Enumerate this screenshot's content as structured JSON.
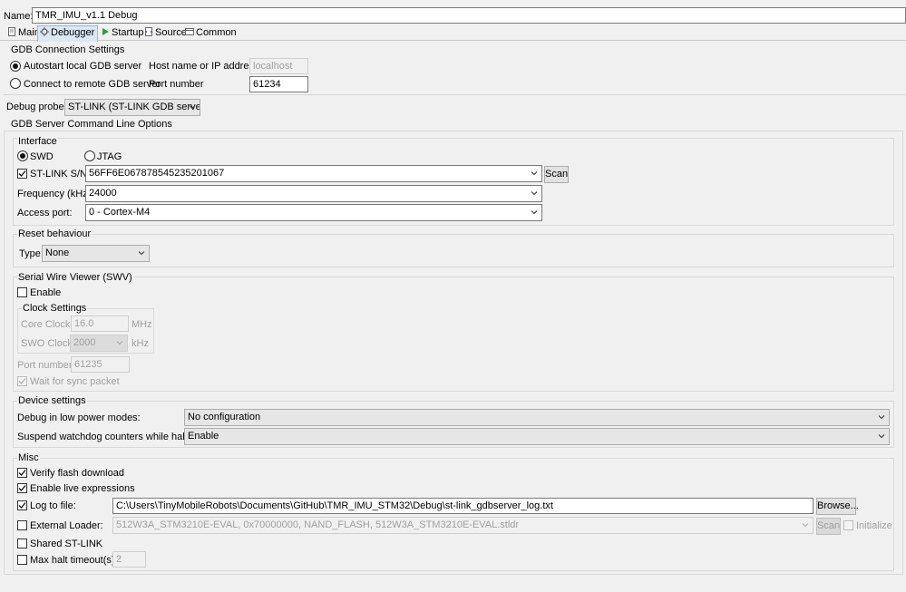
{
  "name": {
    "label": "Name:",
    "value": "TMR_IMU_v1.1 Debug"
  },
  "tabs": [
    {
      "label": "Main",
      "icon": "main-tab-icon"
    },
    {
      "label": "Debugger",
      "icon": "debugger-tab-icon"
    },
    {
      "label": "Startup",
      "icon": "startup-tab-icon"
    },
    {
      "label": "Source",
      "icon": "source-tab-icon"
    },
    {
      "label": "Common",
      "icon": "common-tab-icon"
    }
  ],
  "gdb_connection": {
    "title": "GDB Connection Settings",
    "autostart_label": "Autostart local GDB server",
    "remote_label": "Connect to remote GDB server",
    "host_label": "Host name or IP address",
    "host_value": "localhost",
    "port_label": "Port number",
    "port_value": "61234"
  },
  "debug_probe": {
    "label": "Debug probe",
    "value": "ST-LINK (ST-LINK GDB server)"
  },
  "server_options": {
    "title": "GDB Server Command Line Options"
  },
  "interface": {
    "title": "Interface",
    "swd_label": "SWD",
    "jtag_label": "JTAG",
    "stlink_sn_label": "ST-LINK S/N",
    "stlink_sn_value": "56FF6E067878545235201067",
    "scan_label": "Scan",
    "frequency_label": "Frequency (kHz):",
    "frequency_value": "24000",
    "access_port_label": "Access port:",
    "access_port_value": "0 - Cortex-M4"
  },
  "reset": {
    "title": "Reset behaviour",
    "type_label": "Type:",
    "type_value": "None"
  },
  "swv": {
    "title": "Serial Wire Viewer (SWV)",
    "enable_label": "Enable",
    "clock_title": "Clock Settings",
    "core_clock_label": "Core Clock:",
    "core_clock_value": "16.0",
    "core_clock_unit": "MHz",
    "swo_clock_label": "SWO Clock:",
    "swo_clock_value": "2000",
    "swo_clock_unit": "kHz",
    "port_label": "Port number:",
    "port_value": "61235",
    "wait_sync_label": "Wait for sync packet"
  },
  "device": {
    "title": "Device settings",
    "low_power_label": "Debug in low power modes:",
    "low_power_value": "No configuration",
    "watchdog_label": "Suspend watchdog counters while halted:",
    "watchdog_value": "Enable"
  },
  "misc": {
    "title": "Misc",
    "verify_flash_label": "Verify flash download",
    "live_expr_label": "Enable live expressions",
    "log_file_label": "Log to file:",
    "log_file_value": "C:\\Users\\TinyMobileRobots\\Documents\\GitHub\\TMR_IMU_STM32\\Debug\\st-link_gdbserver_log.txt",
    "browse_label": "Browse...",
    "ext_loader_label": "External Loader:",
    "ext_loader_value": "512W3A_STM3210E-EVAL, 0x70000000, NAND_FLASH, 512W3A_STM3210E-EVAL.stldr",
    "ext_scan_label": "Scan",
    "initialize_label": "Initialize",
    "shared_label": "Shared ST-LINK",
    "max_halt_label": "Max halt timeout(s):",
    "max_halt_value": "2"
  }
}
